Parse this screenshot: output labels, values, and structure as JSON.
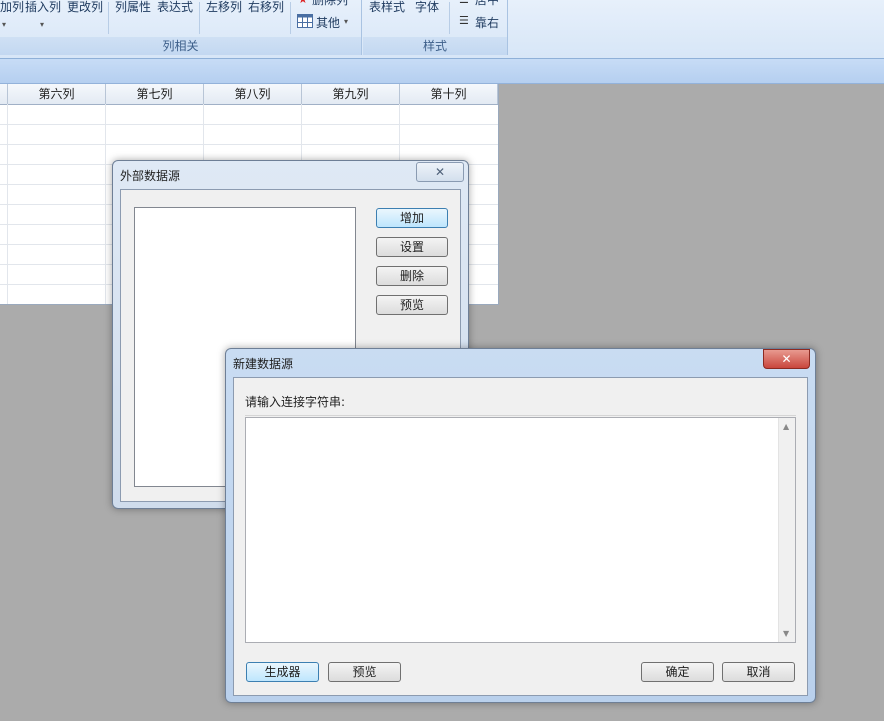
{
  "ribbon": {
    "group1": {
      "buttons": [
        "加列",
        "插入列",
        "更改列",
        "列属性",
        "表达式",
        "左移列",
        "右移列"
      ],
      "top_item": "删除列",
      "other": "其他",
      "caption": "列相关"
    },
    "group2": {
      "buttons": [
        "表样式",
        "字体"
      ],
      "top_item": "居中",
      "align_right": "靠右",
      "caption": "样式"
    }
  },
  "grid": {
    "columns": [
      "第六列",
      "第七列",
      "第八列",
      "第九列",
      "第十列"
    ]
  },
  "external_dialog": {
    "title": "外部数据源",
    "close": "✕",
    "buttons": [
      "增加",
      "设置",
      "删除",
      "预览"
    ]
  },
  "new_dialog": {
    "title": "新建数据源",
    "close": "✕",
    "label": "请输入连接字符串:",
    "connection_string": "",
    "buttons": {
      "generator": "生成器",
      "preview": "预览",
      "ok": "确定",
      "cancel": "取消"
    }
  },
  "colors": {
    "ribbon": "#dbe7f6",
    "workspace": "#ababab",
    "close_button": "#c9463d",
    "focus": "#3c7fb1"
  }
}
